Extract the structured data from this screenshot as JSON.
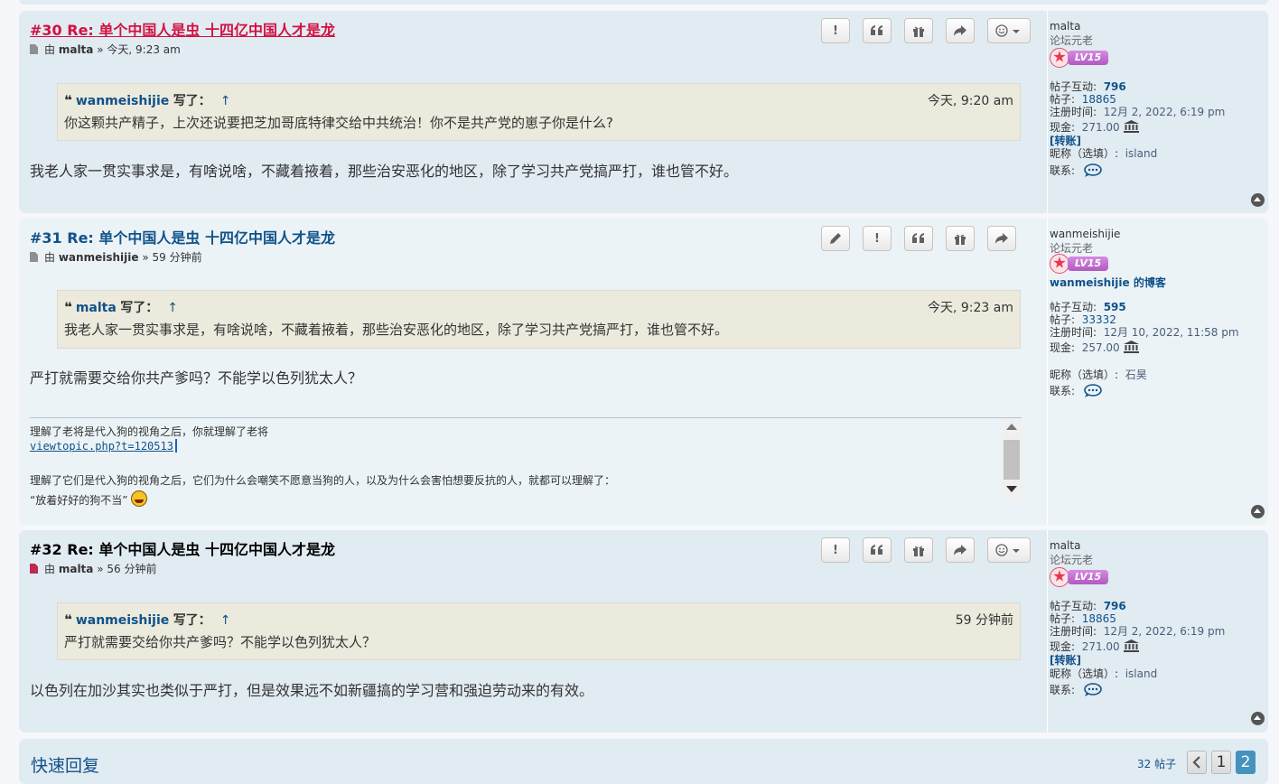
{
  "posts": [
    {
      "title": "#30 Re: 单个中国人是虫 十四亿中国人才是龙",
      "by": "由",
      "author": "malta",
      "time": "» 今天, 9:23 am",
      "quote": {
        "name": "wanmeishijie",
        "wrote": "写了：",
        "up": "↑",
        "time": "今天, 9:20 am",
        "text": "你这颗共产精子，上次还说要把芝加哥底特律交给中共统治！你不是共产党的崽子你是什么?"
      },
      "body": "我老人家一贯实事求是，有啥说啥，不藏着掖着，那些治安恶化的地区，除了学习共产党搞严打，谁也管不好。",
      "profile": {
        "name": "malta",
        "rank": "论坛元老",
        "level": "LV15",
        "interact_label": "帖子互动:",
        "interact": "796",
        "posts_label": "帖子:",
        "posts": "18865",
        "joined_label": "注册时间:",
        "joined": "12月 2, 2022, 6:19 pm",
        "cash_label": "现金:",
        "cash": "271.00",
        "transfer": "[转账]",
        "nick_label": "昵称（选填）:",
        "nick": "island",
        "contact_label": "联系:"
      }
    },
    {
      "title": "#31 Re: 单个中国人是虫 十四亿中国人才是龙",
      "by": "由",
      "author": "wanmeishijie",
      "time": "» 59 分钟前",
      "quote": {
        "name": "malta",
        "wrote": "写了：",
        "up": "↑",
        "time": "今天, 9:23 am",
        "text": "我老人家一贯实事求是，有啥说啥，不藏着掖着，那些治安恶化的地区，除了学习共产党搞严打，谁也管不好。"
      },
      "body": "严打就需要交给你共产爹吗？不能学以色列犹太人？",
      "signature": {
        "line1": "理解了老将是代入狗的视角之后，你就理解了老将",
        "link": "viewtopic.php?t=120513",
        "line3": "理解了它们是代入狗的视角之后，它们为什么会嘲笑不愿意当狗的人，以及为什么会害怕想要反抗的人，就都可以理解了：",
        "line4": "“放着好好的狗不当”"
      },
      "profile": {
        "name": "wanmeishijie",
        "rank": "论坛元老",
        "level": "LV15",
        "blog": "wanmeishijie 的博客",
        "interact_label": "帖子互动:",
        "interact": "595",
        "posts_label": "帖子:",
        "posts": "33332",
        "joined_label": "注册时间:",
        "joined": "12月 10, 2022, 11:58 pm",
        "cash_label": "现金:",
        "cash": "257.00",
        "nick_label": "昵称（选填）:",
        "nick": "石昊",
        "contact_label": "联系:"
      }
    },
    {
      "title": "#32 Re: 单个中国人是虫 十四亿中国人才是龙",
      "by": "由",
      "author": "malta",
      "time": "» 56 分钟前",
      "quote": {
        "name": "wanmeishijie",
        "wrote": "写了：",
        "up": "↑",
        "time": "59 分钟前",
        "text": "严打就需要交给你共产爹吗？不能学以色列犹太人？"
      },
      "body": "以色列在加沙其实也类似于严打，但是效果远不如新疆搞的学习营和强迫劳动来的有效。",
      "profile": {
        "name": "malta",
        "rank": "论坛元老",
        "level": "LV15",
        "interact_label": "帖子互动:",
        "interact": "796",
        "posts_label": "帖子:",
        "posts": "18865",
        "joined_label": "注册时间:",
        "joined": "12月 2, 2022, 6:19 pm",
        "cash_label": "现金:",
        "cash": "271.00",
        "transfer": "[转账]",
        "nick_label": "昵称（选填）:",
        "nick": "island",
        "contact_label": "联系:"
      }
    }
  ],
  "quick_reply": {
    "label": "快速回复",
    "post_count": "32 帖子",
    "pages": [
      "1",
      "2"
    ],
    "current_page": "2"
  },
  "colors": {
    "link": "#105289",
    "unread_title": "#d31141",
    "post_bg_dark": "#e1ebf2",
    "post_bg_light": "#ecf3f7",
    "quote_bg": "#ebeadd",
    "current_page": "#4692bf"
  }
}
